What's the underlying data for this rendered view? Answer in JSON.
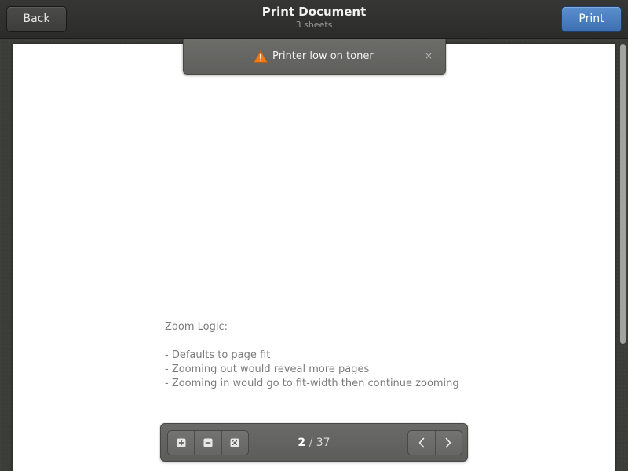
{
  "header": {
    "back_label": "Back",
    "title": "Print Document",
    "subtitle": "3 sheets",
    "print_label": "Print",
    "accent_color": "#4a7fc1"
  },
  "notification": {
    "icon": "warning-icon",
    "icon_color": "#f07a1a",
    "message": "Printer low on toner",
    "close_glyph": "×"
  },
  "document": {
    "lines": [
      "Zoom Logic:",
      "",
      "- Defaults to page fit",
      "- Zooming out would reveal more pages",
      "- Zooming in would go to fit-width then continue zooming"
    ]
  },
  "toolbar": {
    "zoom_buttons": [
      {
        "icon": "zoom-in-icon"
      },
      {
        "icon": "zoom-out-icon"
      },
      {
        "icon": "fit-page-icon"
      }
    ],
    "current_page": "2",
    "separator": "/",
    "total_pages": "37",
    "nav_buttons": [
      {
        "icon": "chevron-left-icon"
      },
      {
        "icon": "chevron-right-icon"
      }
    ]
  }
}
